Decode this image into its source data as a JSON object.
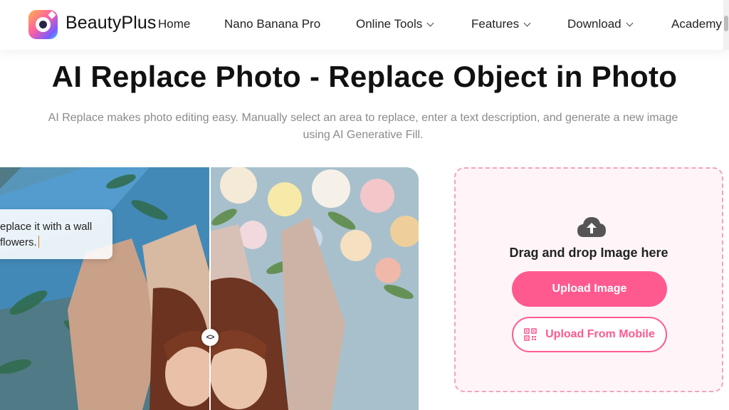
{
  "header": {
    "brand": "BeautyPlus",
    "nav": [
      {
        "label": "Home"
      },
      {
        "label": "Nano Banana Pro"
      },
      {
        "label": "Online Tools"
      },
      {
        "label": "Features"
      },
      {
        "label": "Download"
      },
      {
        "label": "Academy"
      }
    ]
  },
  "hero": {
    "title": "AI Replace Photo - Replace Object in Photo",
    "subtitle_line1": "AI Replace makes photo editing easy. Manually select an area to replace, enter a text description, and generate a new image",
    "subtitle_line2": "using AI Generative Fill."
  },
  "compare": {
    "prompt_line1": "eplace it with a wall",
    "prompt_line2": "flowers."
  },
  "upload": {
    "drag_text": "Drag and drop Image here",
    "upload_button": "Upload Image",
    "mobile_button": "Upload From Mobile"
  },
  "colors": {
    "accent": "#ff5a8f",
    "upload_bg": "#fff5f8",
    "dashed_border": "#f2a3bf"
  }
}
